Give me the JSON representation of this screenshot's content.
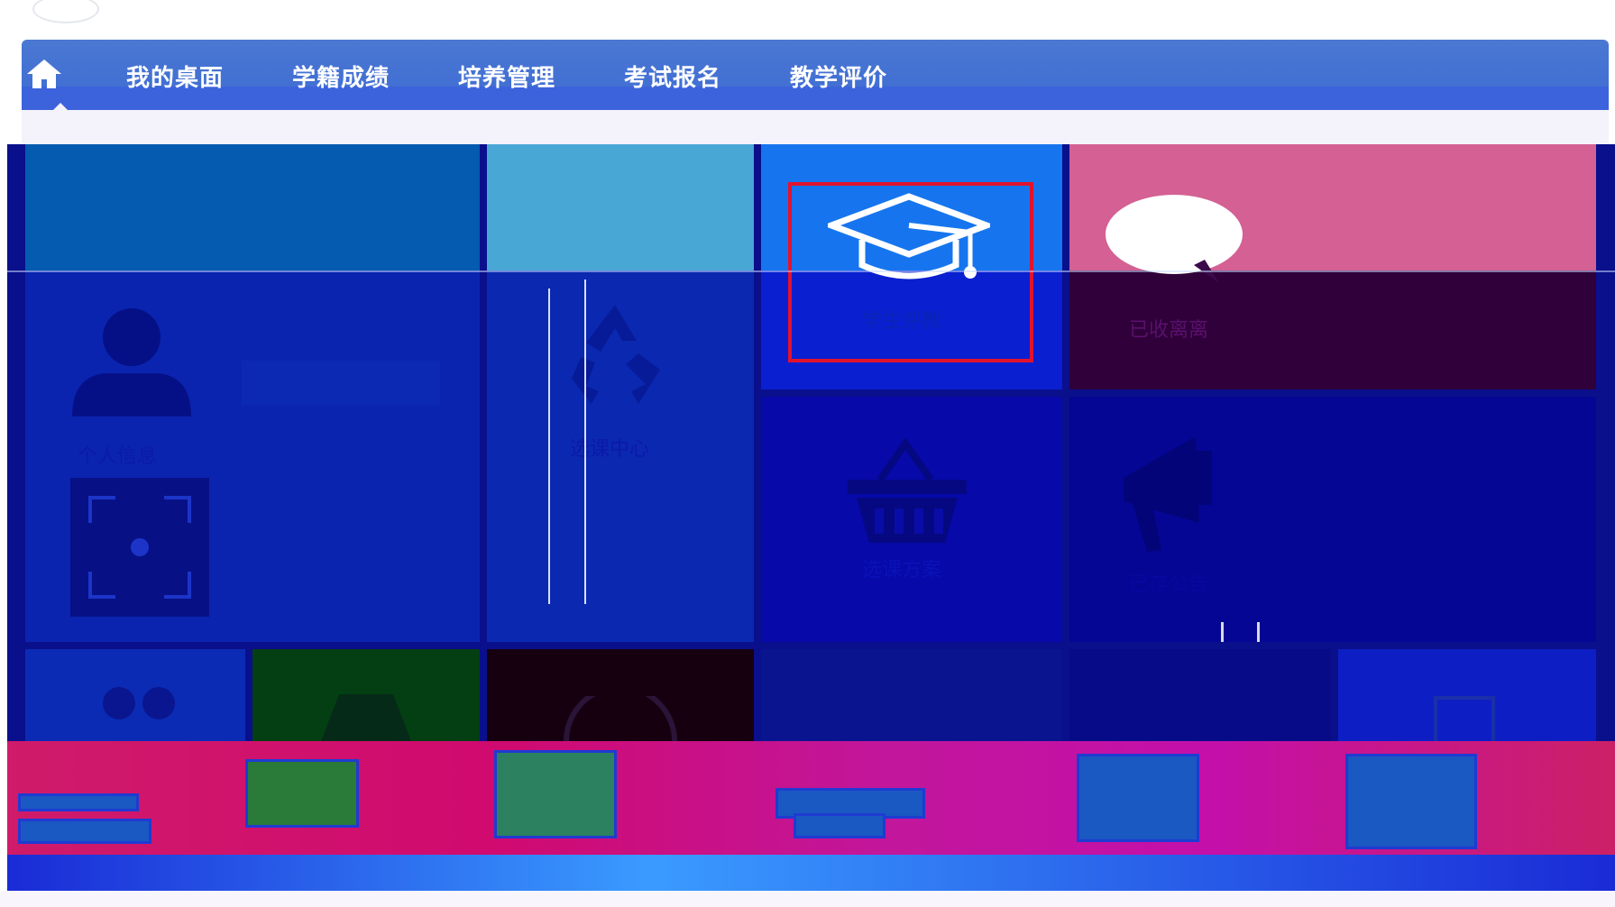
{
  "nav": {
    "home_icon": "home-icon",
    "items": [
      {
        "label": "我的桌面"
      },
      {
        "label": "学籍成绩"
      },
      {
        "label": "培养管理"
      },
      {
        "label": "考试报名"
      },
      {
        "label": "教学评价"
      }
    ]
  },
  "tiles": {
    "student_eval": {
      "label": "学生评教",
      "icon": "graduation-cap-icon"
    },
    "messages": {
      "label": "已收离离",
      "icon": "speech-bubble-icon"
    },
    "personal_info": {
      "label": "个人信息",
      "icon": "user-icon"
    },
    "course_center": {
      "label": "选课中心",
      "icon": "recycle-icon"
    },
    "cart": {
      "label": "选课方案",
      "icon": "basket-icon"
    },
    "notice": {
      "label": "已存公告",
      "icon": "megaphone-icon"
    },
    "qr": {
      "icon": "qr-scan-icon"
    }
  },
  "colors": {
    "nav": "#4a78d2",
    "tile_blue": "#055bb0",
    "tile_sky": "#49a7d6",
    "tile_eval": "#1675ee",
    "tile_pink": "#d46094",
    "highlight": "#e2132e"
  }
}
